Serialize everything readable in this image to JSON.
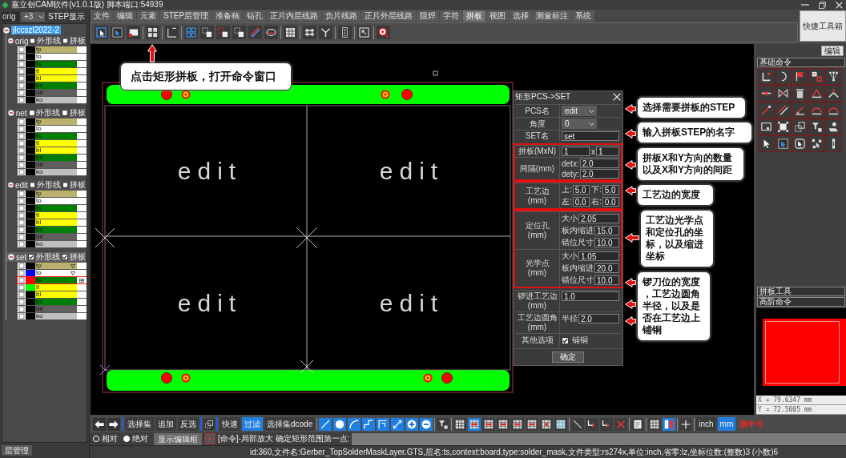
{
  "window": {
    "title": "嘉立创CAM软件(v1.0.1版) 脚本端口:54939"
  },
  "step_panel": {
    "step_field": "orig",
    "count_select": "+3",
    "label": "STEP显示",
    "tree": {
      "label": "jlccszl2022-2",
      "selected": true,
      "expanded": true,
      "children": [
        {
          "name": "orig",
          "selected": false,
          "expanded": true,
          "outline": {
            "label": "外形线",
            "checked": false
          },
          "panelize": {
            "label": "拼板",
            "checked": false
          },
          "layers": [
            {
              "name": "tp",
              "color": "#bab26c",
              "swatch": {
                "color": "#000000"
              },
              "checked": false,
              "selected": false,
              "marked": false
            },
            {
              "name": "to",
              "color": "#ffffff",
              "swatch": {
                "color": "#000000"
              },
              "checked": false,
              "selected": false,
              "marked": false
            },
            {
              "name": "ts",
              "color": "#008000",
              "swatch": {
                "color": "#000000"
              },
              "checked": false,
              "selected": false,
              "marked": false
            },
            {
              "name": "tl",
              "color": "#ffff00",
              "swatch": {
                "color": "#000000"
              },
              "checked": false,
              "selected": false,
              "marked": false
            },
            {
              "name": "bl",
              "color": "#ffff00",
              "swatch": {
                "color": "#000000"
              },
              "checked": false,
              "selected": false,
              "marked": false
            },
            {
              "name": "bs",
              "color": "#008000",
              "swatch": {
                "color": "#000000"
              },
              "checked": false,
              "selected": false,
              "marked": false
            },
            {
              "name": "drl",
              "color": "#5f5f5f",
              "swatch": {
                "color": "#000000"
              },
              "checked": false,
              "selected": false,
              "marked": false
            },
            {
              "name": "ko",
              "color": "#bfbfbf",
              "swatch": {
                "color": "#000000"
              },
              "checked": false,
              "selected": false,
              "marked": false
            }
          ]
        },
        {
          "name": "net",
          "selected": false,
          "expanded": true,
          "outline": {
            "label": "外形线",
            "checked": false
          },
          "panelize": {
            "label": "拼板",
            "checked": false
          },
          "layers": [
            {
              "name": "tp",
              "color": "#bab26c",
              "swatch": {
                "color": "#000000"
              },
              "checked": false,
              "selected": false,
              "marked": false
            },
            {
              "name": "to",
              "color": "#ffffff",
              "swatch": {
                "color": "#000000"
              },
              "checked": false,
              "selected": false,
              "marked": false
            },
            {
              "name": "ts",
              "color": "#008000",
              "swatch": {
                "color": "#000000"
              },
              "checked": false,
              "selected": false,
              "marked": false
            },
            {
              "name": "tl",
              "color": "#ffff00",
              "swatch": {
                "color": "#000000"
              },
              "checked": false,
              "selected": false,
              "marked": false
            },
            {
              "name": "bl",
              "color": "#ffff00",
              "swatch": {
                "color": "#000000"
              },
              "checked": false,
              "selected": false,
              "marked": false
            },
            {
              "name": "bs",
              "color": "#008000",
              "swatch": {
                "color": "#000000"
              },
              "checked": false,
              "selected": false,
              "marked": false
            },
            {
              "name": "drl",
              "color": "#5f5f5f",
              "swatch": {
                "color": "#000000"
              },
              "checked": false,
              "selected": false,
              "marked": false
            },
            {
              "name": "ko",
              "color": "#bfbfbf",
              "swatch": {
                "color": "#000000"
              },
              "checked": false,
              "selected": false,
              "marked": false
            }
          ]
        },
        {
          "name": "edit",
          "selected": false,
          "expanded": true,
          "outline": {
            "label": "外形线",
            "checked": false
          },
          "panelize": {
            "label": "拼板",
            "checked": false
          },
          "layers": [
            {
              "name": "tp",
              "color": "#bab26c",
              "swatch": {
                "color": "#000000"
              },
              "checked": false,
              "selected": false,
              "marked": false
            },
            {
              "name": "to",
              "color": "#ffffff",
              "swatch": {
                "color": "#000000"
              },
              "checked": false,
              "selected": false,
              "marked": false
            },
            {
              "name": "ts",
              "color": "#008000",
              "swatch": {
                "color": "#000000"
              },
              "checked": false,
              "selected": false,
              "marked": false
            },
            {
              "name": "tl",
              "color": "#ffff00",
              "swatch": {
                "color": "#000000"
              },
              "checked": false,
              "selected": false,
              "marked": false
            },
            {
              "name": "bl",
              "color": "#ffff00",
              "swatch": {
                "color": "#000000"
              },
              "checked": false,
              "selected": false,
              "marked": false
            },
            {
              "name": "bs",
              "color": "#008000",
              "swatch": {
                "color": "#000000"
              },
              "checked": false,
              "selected": false,
              "marked": false
            },
            {
              "name": "drl",
              "color": "#5f5f5f",
              "swatch": {
                "color": "#000000"
              },
              "checked": false,
              "selected": false,
              "marked": false
            },
            {
              "name": "ko",
              "color": "#bfbfbf",
              "swatch": {
                "color": "#000000"
              },
              "checked": false,
              "selected": false,
              "marked": false
            }
          ]
        },
        {
          "name": "set",
          "selected": true,
          "expanded": true,
          "outline": {
            "label": "外形线",
            "checked": true
          },
          "panelize": {
            "label": "拼板",
            "checked": true
          },
          "layers": [
            {
              "name": "tp",
              "color": "#bab26c",
              "swatch": {
                "color": "#000000"
              },
              "checked": false,
              "selected": false,
              "marked": true
            },
            {
              "name": "to",
              "color": "#ffffff",
              "swatch": {
                "color": "#0000ff"
              },
              "checked": false,
              "selected": false,
              "marked": true
            },
            {
              "name": "ts",
              "color": "#008000",
              "swatch": {
                "color": "#ff0000"
              },
              "checked": false,
              "selected": true,
              "marked": false
            },
            {
              "name": "tl",
              "color": "#ffff00",
              "swatch": {
                "color": "#00ff00"
              },
              "checked": false,
              "selected": false,
              "marked": false
            },
            {
              "name": "bl",
              "color": "#ffff00",
              "swatch": {
                "color": "#000000"
              },
              "checked": false,
              "selected": false,
              "marked": false
            },
            {
              "name": "bs",
              "color": "#008000",
              "swatch": {
                "color": "#000000"
              },
              "checked": false,
              "selected": false,
              "marked": false
            },
            {
              "name": "drl",
              "color": "#5f5f5f",
              "swatch": {
                "color": "#000000"
              },
              "checked": false,
              "selected": false,
              "marked": false
            },
            {
              "name": "ko",
              "color": "#bfbfbf",
              "swatch": {
                "color": "#000000"
              },
              "checked": false,
              "selected": false,
              "marked": false
            }
          ]
        }
      ]
    },
    "bottom_tab": "层管理"
  },
  "menu": [
    {
      "label": "文件",
      "selected": false
    },
    {
      "label": "编辑",
      "selected": false
    },
    {
      "label": "元素",
      "selected": false
    },
    {
      "label": "STEP层管理",
      "selected": false
    },
    {
      "label": "准备稿",
      "selected": false
    },
    {
      "label": "钻孔",
      "selected": false
    },
    {
      "label": "正片内层线路",
      "selected": false
    },
    {
      "label": "负片线路",
      "selected": false
    },
    {
      "label": "正片外层线路",
      "selected": false
    },
    {
      "label": "阻焊",
      "selected": false
    },
    {
      "label": "字符",
      "selected": false
    },
    {
      "label": "拼板",
      "selected": true
    },
    {
      "label": "视图",
      "selected": false
    },
    {
      "label": "选择",
      "selected": false
    },
    {
      "label": "测量标注",
      "selected": false
    },
    {
      "label": "系统",
      "selected": false
    }
  ],
  "quick_toolbox": {
    "label": "快捷工具箱"
  },
  "canvas": {
    "units": [
      {
        "label": "edit"
      },
      {
        "label": "edit"
      },
      {
        "label": "edit"
      },
      {
        "label": "edit"
      }
    ],
    "hint": {
      "text": "点击矩形拼板，打开命令窗口"
    }
  },
  "dialog": {
    "title": "矩形PCS->SET",
    "sections": [
      {
        "highlighted": false,
        "rows": [
          {
            "label": "PCS名",
            "kind": "select",
            "fields": [
              {
                "value": "edit"
              }
            ]
          },
          {
            "label": "角度",
            "kind": "select",
            "fields": [
              {
                "value": "0"
              }
            ]
          },
          {
            "label": "SET名",
            "kind": "stack",
            "fields": [
              {
                "value": "set"
              }
            ]
          }
        ]
      },
      {
        "highlighted": true,
        "rows": [
          {
            "label": "拼板(MxN)",
            "kind": "grid",
            "fields": [
              {
                "value": "1"
              },
              {
                "prefix": "x",
                "value": "1"
              }
            ]
          },
          {
            "label": "间隔(mm)",
            "kind": "stack",
            "fields": [
              {
                "prefix": "detx:",
                "value": "2.0"
              },
              {
                "prefix": "dety:",
                "value": "2.0"
              }
            ]
          }
        ]
      },
      {
        "highlighted": true,
        "rows": [
          {
            "label": "工艺边(mm)",
            "kind": "grid",
            "fields": [
              {
                "prefix": "上:",
                "value": "5.0"
              },
              {
                "prefix": "下:",
                "value": "5.0"
              },
              {
                "prefix": "左:",
                "value": "0.0"
              },
              {
                "prefix": "右:",
                "value": "0.0"
              }
            ]
          }
        ]
      },
      {
        "highlighted": true,
        "rows": [
          {
            "label": "定位孔(mm)",
            "kind": "stack",
            "fields": [
              {
                "prefix": "大小",
                "value": "2.05"
              },
              {
                "prefix": "板内缩进",
                "value": "15.0"
              },
              {
                "prefix": "错位尺寸",
                "value": "10.0"
              }
            ]
          },
          {
            "label": "光学点(mm)",
            "kind": "stack",
            "fields": [
              {
                "prefix": "大小",
                "value": "1.05"
              },
              {
                "prefix": "板内缩进",
                "value": "20.0"
              },
              {
                "prefix": "错位尺寸",
                "value": "10.0"
              }
            ]
          }
        ]
      },
      {
        "highlighted": false,
        "rows": [
          {
            "label": "锣进工艺边(mm)",
            "kind": "stack",
            "fields": [
              {
                "value": "1.0"
              }
            ]
          },
          {
            "label": "工艺边圆角(mm)",
            "kind": "stack",
            "fields": [
              {
                "prefix": "半径",
                "value": "2.0"
              }
            ]
          },
          {
            "label": "其他选项",
            "kind": "checkbox",
            "fields": [
              {
                "label": "铺铜",
                "checked": true
              }
            ]
          }
        ]
      }
    ],
    "confirm_button": "确定"
  },
  "callouts": [
    {
      "text": "选择需要拼板的STEP"
    },
    {
      "text": "输入拼板STEP的名字"
    },
    {
      "text": "拼板X和Y方向的数量以及X和Y方向的间距"
    },
    {
      "text": "工艺边的宽度"
    },
    {
      "text": "工艺边光学点和定位孔的坐标，以及缩进坐标"
    },
    {
      "text": "锣刀位的宽度，工艺边圆角半径，以及是否在工艺边上铺铜"
    }
  ],
  "right_panel": {
    "edit_button": "编辑",
    "basic_commands": "基础命令",
    "panel_tools": "拼板工具",
    "advanced_commands": "高阶命令",
    "coords": [
      "X = 79.6347 mm",
      "Y = 72.5005 mm"
    ]
  },
  "bottom_toolbar": {
    "buttons": [
      {
        "label": "选择集",
        "selected": false
      },
      {
        "label": "追加",
        "selected": false
      },
      {
        "label": "反选",
        "selected": false
      },
      {
        "label": "快速",
        "selected": false
      },
      {
        "label": "过滤",
        "selected": true
      },
      {
        "label": "选择集dcode",
        "selected": false
      }
    ],
    "tools": [
      {
        "selected": true
      },
      {
        "selected": true
      },
      {
        "selected": true
      },
      {
        "selected": true
      },
      {
        "selected": true
      },
      {
        "selected": true
      },
      {
        "selected": true
      },
      {
        "selected": true
      },
      {
        "selected": false
      },
      {
        "selected": false
      },
      {
        "selected": true
      },
      {
        "selected": false
      },
      {
        "selected": false
      },
      {
        "selected": false
      },
      {
        "selected": false
      },
      {
        "selected": false
      },
      {
        "selected": false
      },
      {
        "selected": false
      },
      {
        "selected": false
      },
      {
        "selected": false
      },
      {
        "selected": false
      },
      {
        "selected": false
      },
      {
        "selected": false
      },
      {
        "selected": true
      },
      {
        "selected": false
      }
    ],
    "units": [
      {
        "label": "inch",
        "selected": false
      },
      {
        "label": "mm",
        "selected": true
      }
    ],
    "readout": "选中:0"
  },
  "command_row": {
    "modes": [
      {
        "label": "相对",
        "selected": false
      },
      {
        "label": "绝对",
        "selected": true
      }
    ],
    "editor_button": "显示编辑框",
    "prompt": "[命令]-局部放大 确定矩形范围第一点:"
  },
  "status_bar": {
    "text": "id:360,文件名:Gerber_TopSolderMaskLayer.GTS,层名:ts,context:board,type:solder_mask,文件类型:rs274x,单位:inch,省零:lz,坐标位数:(整数)3 (小数)6"
  }
}
